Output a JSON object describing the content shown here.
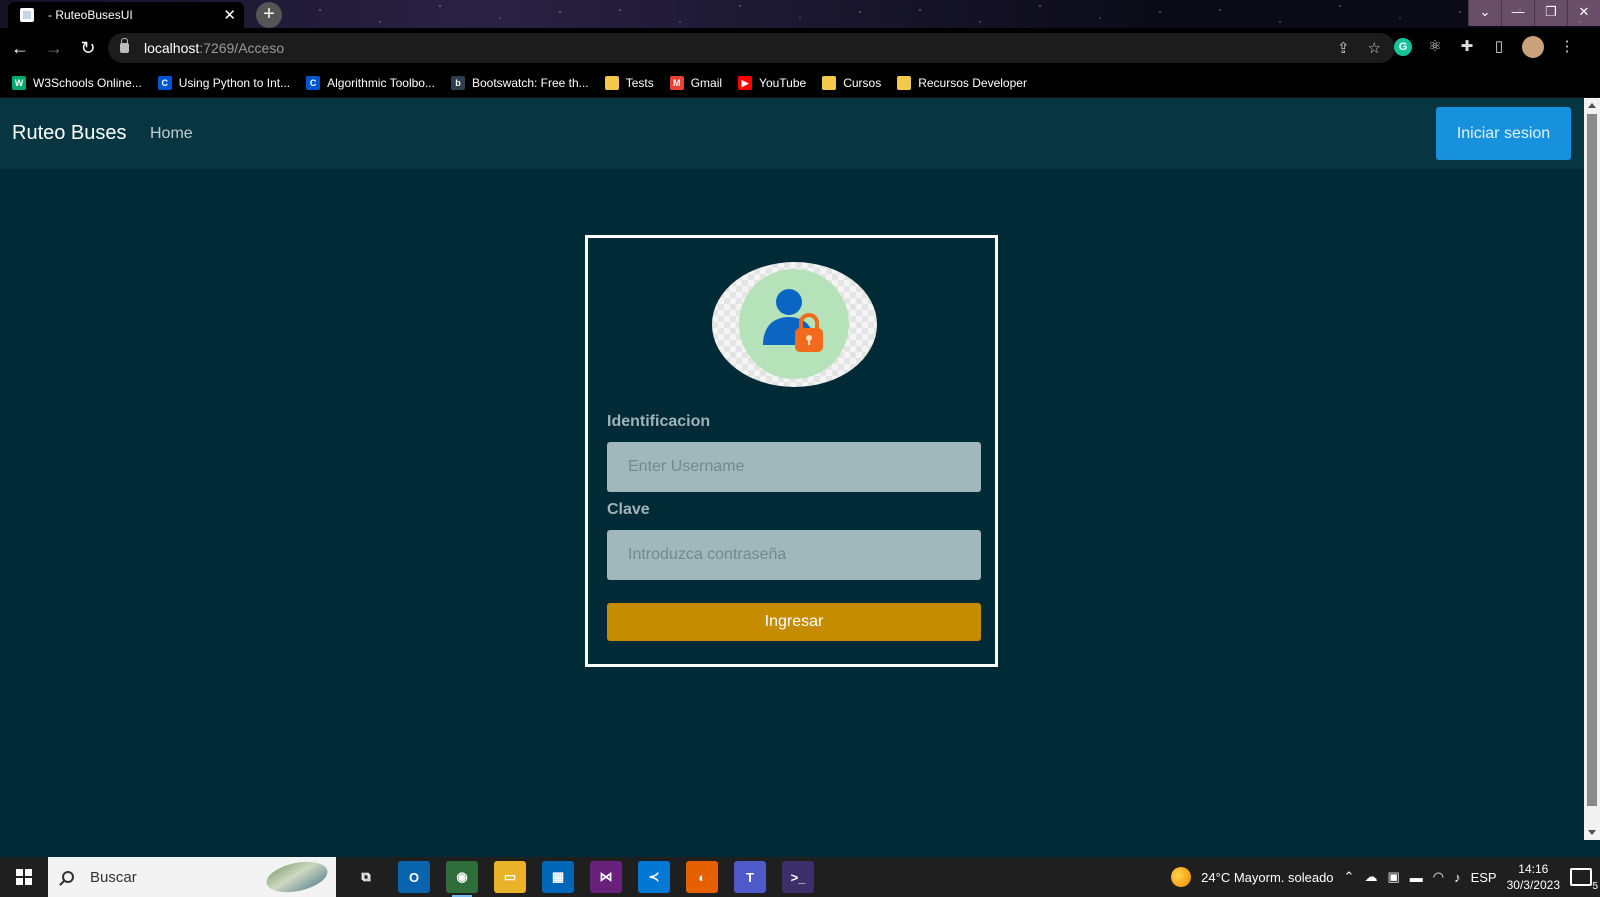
{
  "browser": {
    "tab_title": "- RuteoBusesUI",
    "tab_close": "✕",
    "new_tab": "+",
    "window_controls": [
      "⌄",
      "—",
      "❐",
      "✕"
    ],
    "nav": {
      "back": "←",
      "forward": "→",
      "reload": "↻"
    },
    "url_host": "localhost",
    "url_path": ":7269/Acceso",
    "bookmarks": [
      {
        "label": "W3Schools Online...",
        "icon": "w3schools-icon",
        "color": "#04aa6d",
        "glyph": "W"
      },
      {
        "label": "Using Python to Int...",
        "icon": "coursera-icon",
        "color": "#0056d2",
        "glyph": "C"
      },
      {
        "label": "Algorithmic Toolbo...",
        "icon": "coursera-icon",
        "color": "#0056d2",
        "glyph": "C"
      },
      {
        "label": "Bootswatch: Free th...",
        "icon": "bootswatch-icon",
        "color": "#2c3e50",
        "glyph": "b"
      },
      {
        "label": "Tests",
        "icon": "folder-icon",
        "color": "#f2c94c",
        "glyph": ""
      },
      {
        "label": "Gmail",
        "icon": "gmail-icon",
        "color": "#ea4335",
        "glyph": "M"
      },
      {
        "label": "YouTube",
        "icon": "youtube-icon",
        "color": "#ff0000",
        "glyph": "▶"
      },
      {
        "label": "Cursos",
        "icon": "folder-icon",
        "color": "#f2c94c",
        "glyph": ""
      },
      {
        "label": "Recursos Developer",
        "icon": "folder-icon",
        "color": "#f2c94c",
        "glyph": ""
      }
    ]
  },
  "app": {
    "brand": "Ruteo Buses",
    "nav_home": "Home",
    "login_button": "Iniciar sesion",
    "colors": {
      "background": "#002b36",
      "navbar": "#073642",
      "primary": "#1891dd",
      "warning": "#c58c00"
    }
  },
  "form": {
    "id_label": "Identificacion",
    "id_placeholder": "Enter Username",
    "password_label": "Clave",
    "password_placeholder": "Introduzca contraseña",
    "submit": "Ingresar"
  },
  "taskbar": {
    "search_placeholder": "Buscar",
    "weather": "24°C  Mayorm. soleado",
    "language": "ESP",
    "time": "14:16",
    "date": "30/3/2023",
    "notifications": "5",
    "apps": [
      {
        "name": "task-view-icon",
        "glyph": "⧉",
        "color": "#1f1f1f"
      },
      {
        "name": "outlook-icon",
        "glyph": "O",
        "color": "#0a64ad"
      },
      {
        "name": "chrome-icon",
        "glyph": "◉",
        "color": "#2f6e3a"
      },
      {
        "name": "file-explorer-icon",
        "glyph": "▭",
        "color": "#e8b229"
      },
      {
        "name": "microsoft-store-icon",
        "glyph": "▦",
        "color": "#0067b8"
      },
      {
        "name": "visual-studio-icon",
        "glyph": "⋈",
        "color": "#68217a"
      },
      {
        "name": "vscode-icon",
        "glyph": "≺",
        "color": "#0078d4"
      },
      {
        "name": "firefox-icon",
        "glyph": "◐",
        "color": "#e66000"
      },
      {
        "name": "teams-icon",
        "glyph": "T",
        "color": "#5059c9"
      },
      {
        "name": "terminal-icon",
        "glyph": ">_",
        "color": "#3b2f6a"
      }
    ]
  }
}
